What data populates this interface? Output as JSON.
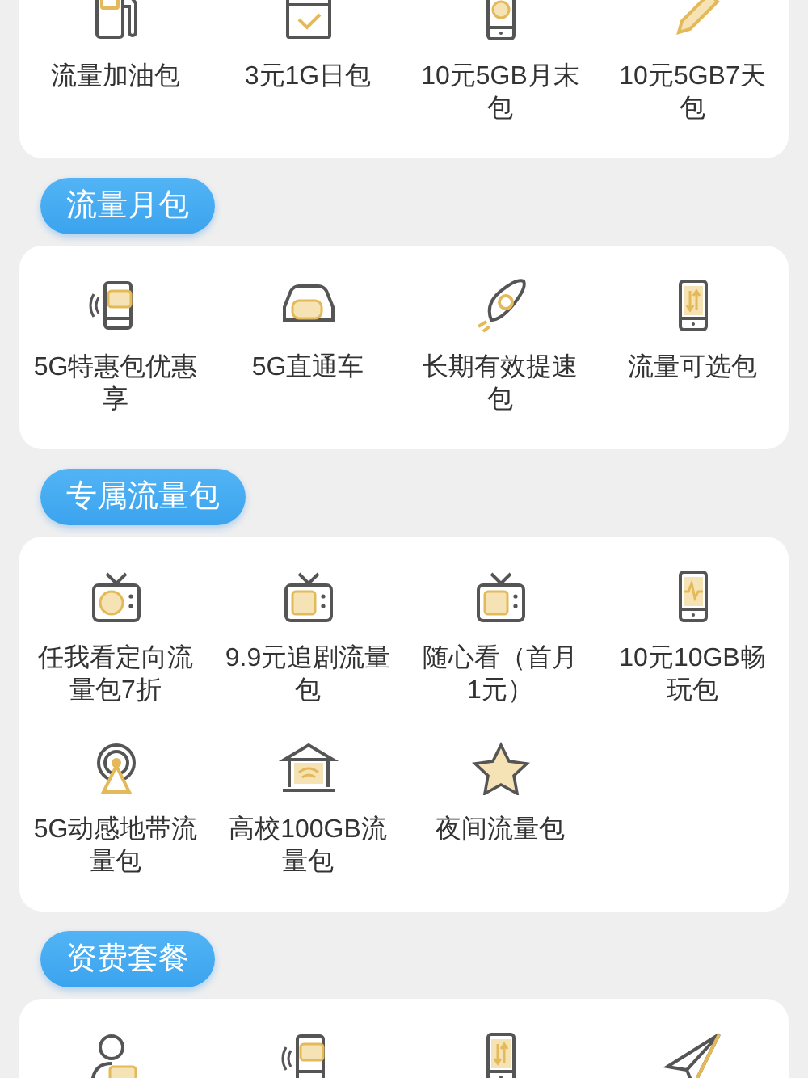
{
  "sections": [
    {
      "items": [
        {
          "kind": "fuel-pump",
          "label": "流量加油包"
        },
        {
          "kind": "calendar",
          "label": "3元1G日包"
        },
        {
          "kind": "phone-drop",
          "label": "10元5GB月末包"
        },
        {
          "kind": "pencil",
          "label": "10元5GB7天包"
        }
      ]
    },
    {
      "title": "流量月包",
      "items": [
        {
          "kind": "phone-5g",
          "label": "5G特惠包优惠享"
        },
        {
          "kind": "car",
          "label": "5G直通车"
        },
        {
          "kind": "rocket",
          "label": "长期有效提速包"
        },
        {
          "kind": "phone-arrows",
          "label": "流量可选包"
        }
      ]
    },
    {
      "title": "专属流量包",
      "items": [
        {
          "kind": "tv-chart",
          "label": "任我看定向流量包7折"
        },
        {
          "kind": "tv",
          "label": "9.9元追剧流量包"
        },
        {
          "kind": "tv",
          "label": "随心看（首月1元）"
        },
        {
          "kind": "phone-pulse",
          "label": "10元10GB畅玩包"
        },
        {
          "kind": "antenna",
          "label": "5G动感地带流量包"
        },
        {
          "kind": "school",
          "label": "高校100GB流量包"
        },
        {
          "kind": "star",
          "label": "夜间流量包"
        }
      ]
    },
    {
      "title": "资费套餐",
      "items": [
        {
          "kind": "person-5g"
        },
        {
          "kind": "phone-5g"
        },
        {
          "kind": "phone-arrows"
        },
        {
          "kind": "paper-plane"
        }
      ]
    }
  ]
}
